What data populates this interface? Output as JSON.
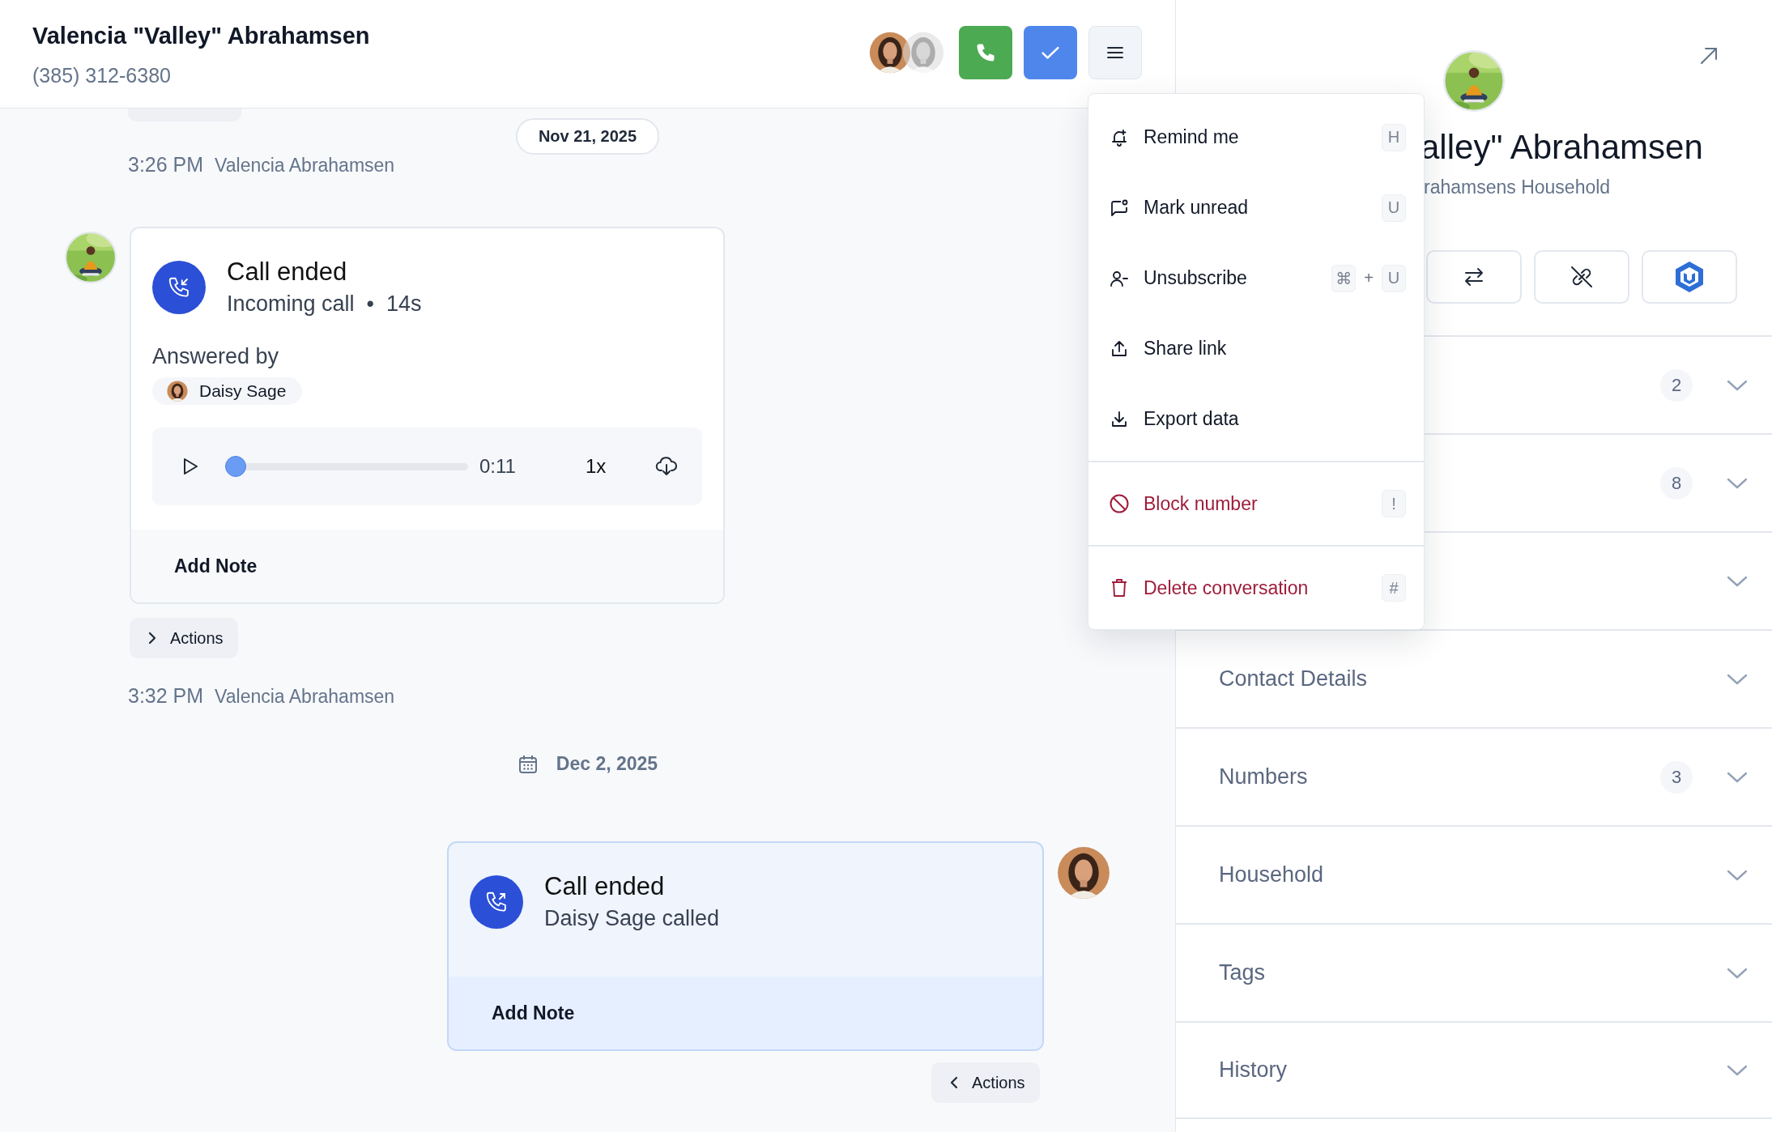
{
  "header": {
    "title": "Valencia \"Valley\" Abrahamsen",
    "phone": "(385) 312-6380",
    "actions": [
      {
        "kind": "call"
      },
      {
        "kind": "done"
      },
      {
        "kind": "menu",
        "expanded": true
      }
    ]
  },
  "timeline": [
    {
      "kind": "date_pill",
      "text": "Nov 21, 2025"
    },
    {
      "kind": "meta",
      "time": "3:26 PM",
      "author": "Valencia Abrahamsen"
    },
    {
      "kind": "incoming_call",
      "title": "Call ended",
      "subtitle": "Incoming call  •  14s",
      "answered_label": "Answered by",
      "answered_by": "Daisy Sage",
      "player": {
        "level": 0,
        "time": "0:11",
        "speed": "1x"
      },
      "note_button": "Add Note"
    },
    {
      "kind": "actions",
      "label": "Actions"
    },
    {
      "kind": "meta",
      "time": "3:32 PM",
      "author": "Valencia Abrahamsen"
    },
    {
      "kind": "date",
      "text": "Dec 2, 2025"
    },
    {
      "kind": "outgoing_call",
      "title": "Call ended",
      "subtitle": "Daisy Sage called",
      "note_button": "Add Note"
    },
    {
      "kind": "actions",
      "label": "Actions"
    }
  ],
  "menu": {
    "groups": [
      [
        {
          "label": "Remind me",
          "danger": false,
          "shortcut": {
            "keys": [
              "H"
            ]
          }
        },
        {
          "label": "Mark unread",
          "danger": false,
          "shortcut": {
            "keys": [
              "U"
            ]
          }
        },
        {
          "label": "Unsubscribe",
          "danger": false,
          "shortcut": {
            "keys": [
              "⌘",
              "U"
            ],
            "joiner": "+"
          }
        },
        {
          "label": "Share link",
          "danger": false
        },
        {
          "label": "Export data",
          "danger": false
        }
      ],
      [
        {
          "label": "Block number",
          "danger": true,
          "shortcut": {
            "keys": [
              "!"
            ]
          }
        }
      ],
      [
        {
          "label": "Delete conversation",
          "danger": true,
          "shortcut": {
            "keys": [
              "#"
            ]
          }
        }
      ]
    ]
  },
  "side_panel": {
    "name": "alley\" Abrahamsen",
    "household": "rahamsens Household",
    "buttons": [
      {
        "kind": "transfer"
      },
      {
        "kind": "unlink"
      },
      {
        "kind": "brand"
      }
    ],
    "sections": [
      {
        "count": "2",
        "expanded": false
      },
      {
        "count": "8",
        "expanded": false
      },
      {
        "expanded": false
      },
      {
        "title": "Contact Details",
        "expanded": false
      },
      {
        "title": "Numbers",
        "count": "3",
        "expanded": false
      },
      {
        "title": "Household",
        "expanded": false
      },
      {
        "title": "Tags",
        "expanded": false
      },
      {
        "title": "History",
        "expanded": false
      }
    ]
  }
}
